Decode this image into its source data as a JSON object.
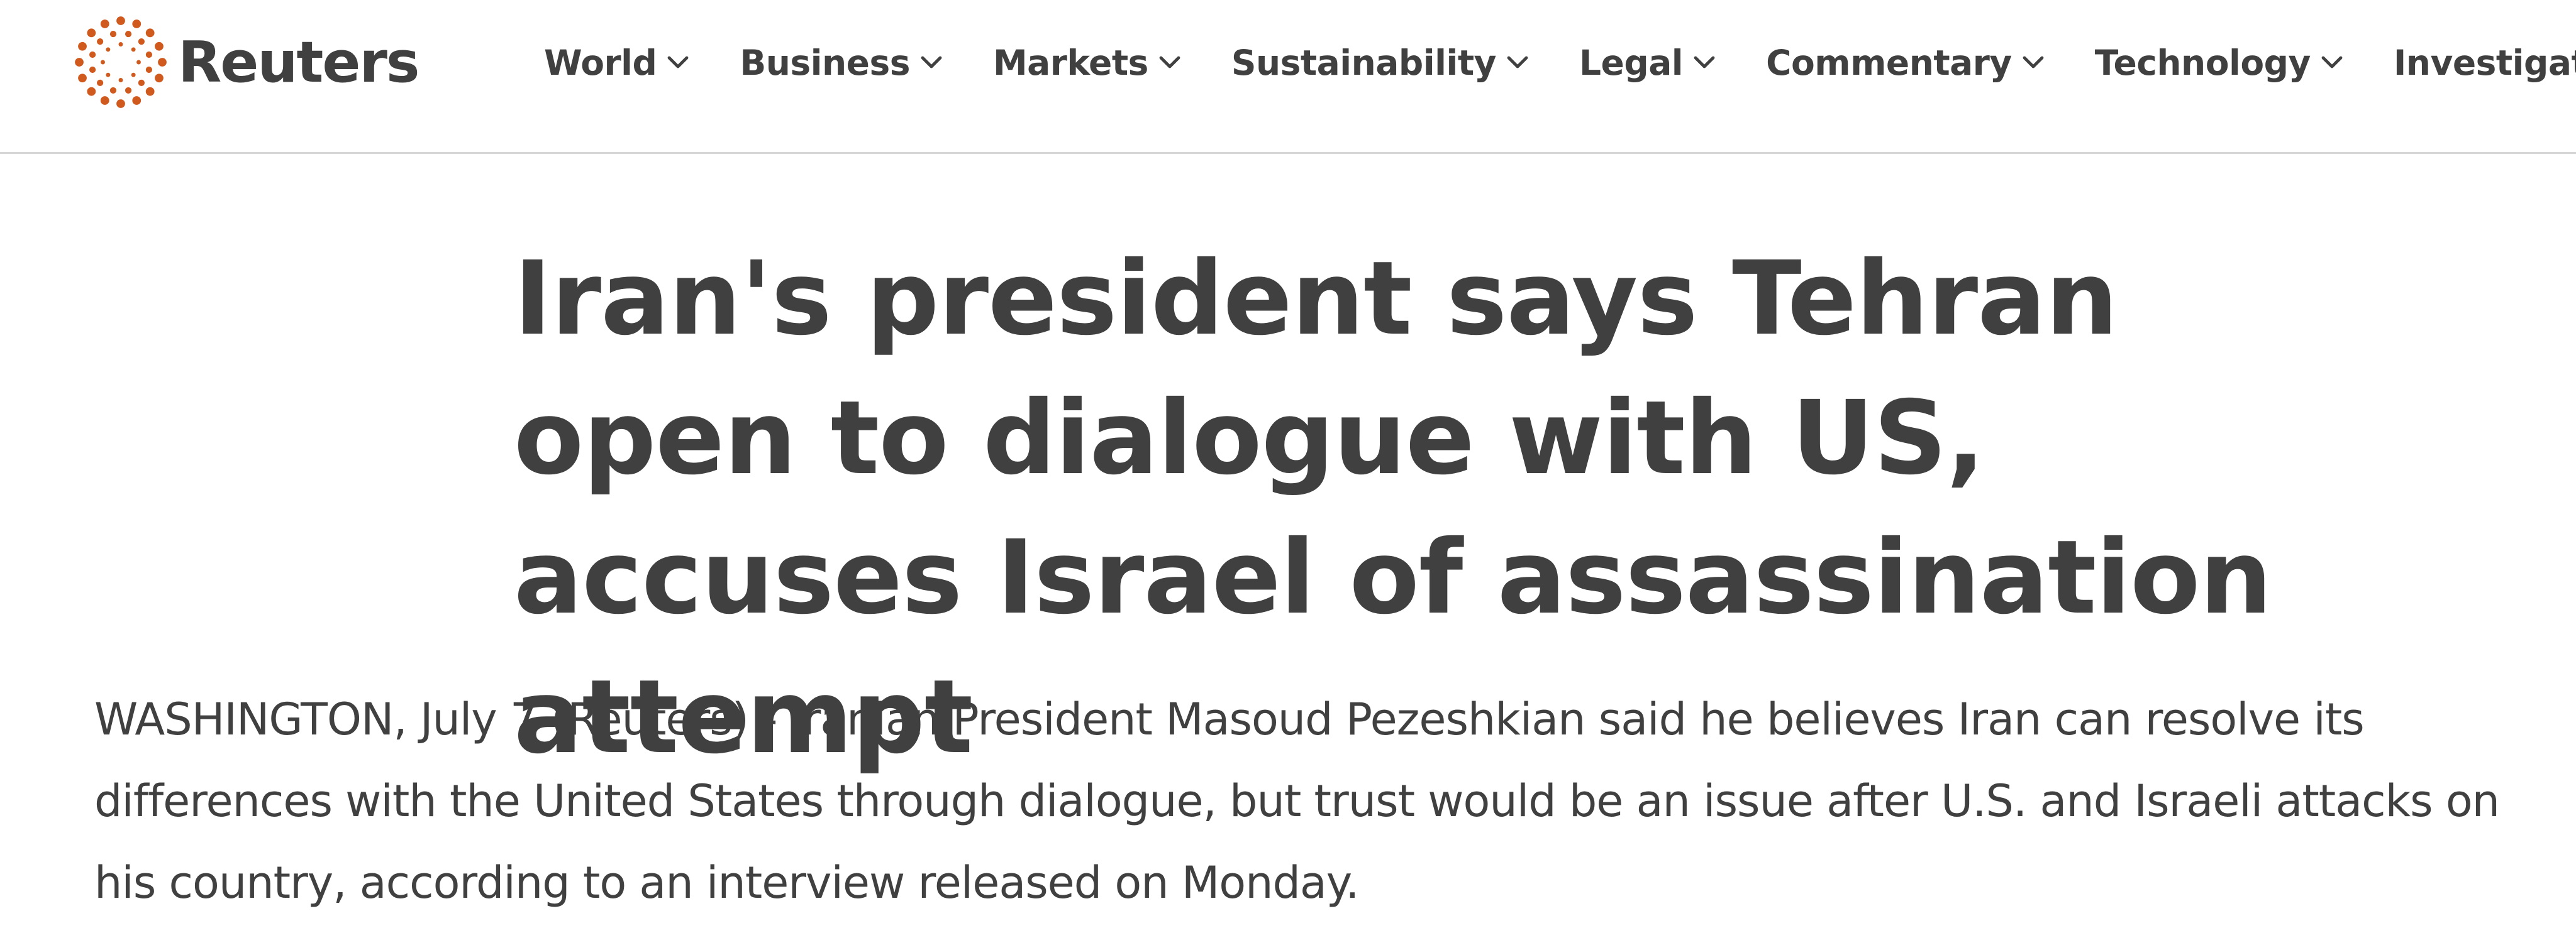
{
  "brand": {
    "name": "Reuters",
    "accent_color": "#d05a1e"
  },
  "nav": {
    "items": [
      {
        "label": "World",
        "icon": "chevron-down-icon"
      },
      {
        "label": "Business",
        "icon": "chevron-down-icon"
      },
      {
        "label": "Markets",
        "icon": "chevron-down-icon"
      },
      {
        "label": "Sustainability",
        "icon": "chevron-down-icon"
      },
      {
        "label": "Legal",
        "icon": "chevron-down-icon"
      },
      {
        "label": "Commentary",
        "icon": "chevron-down-icon"
      },
      {
        "label": "Technology",
        "icon": "chevron-down-icon"
      },
      {
        "label": "Investigations"
      }
    ]
  },
  "article": {
    "headline": "Iran's president says Tehran open to dialogue with US, accuses Israel of assassination attempt",
    "lede": "WASHINGTON, July 7 (Reuters) - Iranian President Masoud Pezeshkian said he believes Iran can resolve its differences with the United States through dialogue, but trust would be an issue after U.S. and Israeli attacks on his country, according to an interview released on Monday."
  }
}
